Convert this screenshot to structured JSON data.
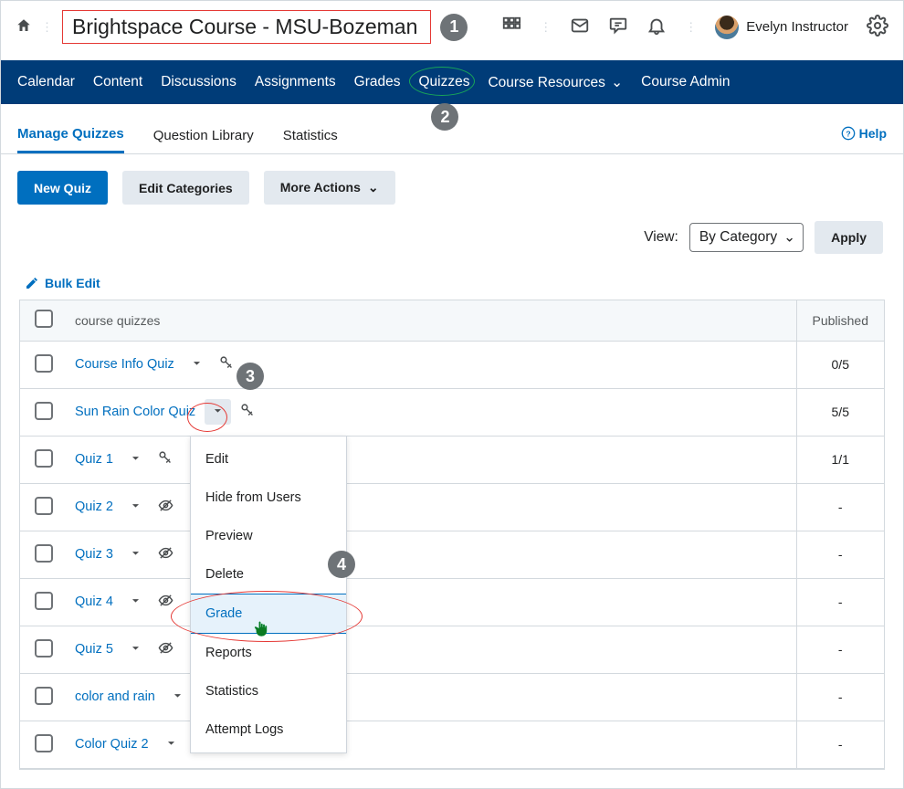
{
  "header": {
    "course_title": "Brightspace Course - MSU-Bozeman",
    "user_name": "Evelyn Instructor"
  },
  "nav": {
    "items": [
      "Calendar",
      "Content",
      "Discussions",
      "Assignments",
      "Grades",
      "Quizzes",
      "Course Resources",
      "Course Admin"
    ]
  },
  "tabs": {
    "items": [
      "Manage Quizzes",
      "Question Library",
      "Statistics"
    ],
    "active": 0,
    "help_label": "Help"
  },
  "actions": {
    "new_quiz": "New Quiz",
    "edit_categories": "Edit Categories",
    "more_actions": "More Actions"
  },
  "view": {
    "label": "View:",
    "selected": "By Category",
    "apply": "Apply"
  },
  "bulk_edit": "Bulk Edit",
  "table": {
    "header_category": "course quizzes",
    "header_published": "Published",
    "rows": [
      {
        "name": "Course Info Quiz",
        "icon": "key",
        "published": "0/5"
      },
      {
        "name": "Sun Rain Color Quiz",
        "icon": "key",
        "published": "5/5",
        "caret_hl": true
      },
      {
        "name": "Quiz 1",
        "icon": "key",
        "published": "1/1"
      },
      {
        "name": "Quiz 2",
        "icon": "hidden",
        "published": "-"
      },
      {
        "name": "Quiz 3",
        "icon": "hidden",
        "published": "-"
      },
      {
        "name": "Quiz 4",
        "icon": "hidden",
        "published": "-"
      },
      {
        "name": "Quiz 5",
        "icon": "hidden",
        "published": "-"
      },
      {
        "name": "color and rain",
        "icon": "",
        "published": "-"
      },
      {
        "name": "Color Quiz 2",
        "icon": "",
        "published": "-"
      }
    ]
  },
  "menu": {
    "items": [
      "Edit",
      "Hide from Users",
      "Preview",
      "Delete",
      "Grade",
      "Reports",
      "Statistics",
      "Attempt Logs"
    ],
    "highlighted": 4
  },
  "badges": {
    "b1": "1",
    "b2": "2",
    "b3": "3",
    "b4": "4"
  }
}
